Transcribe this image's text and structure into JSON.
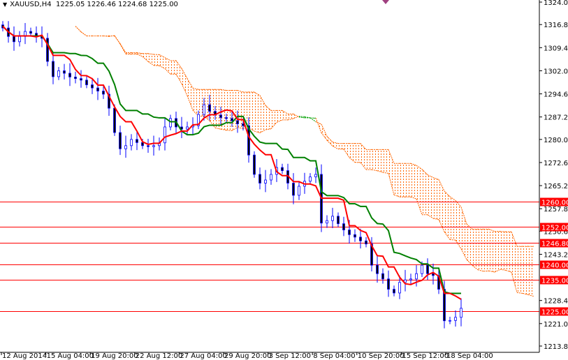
{
  "header": {
    "symbol": "XAUUSD,H4",
    "ohlc": "1225.05 1226.46 1224.68 1225.00"
  },
  "colors": {
    "tenkan": "#ff0000",
    "kijun": "#008000",
    "candle": "#0000ff",
    "level": "#ff0000",
    "cloud_bear": "#ff6600",
    "cloud_bull": "#00a000"
  },
  "chart_data": {
    "type": "candlestick",
    "title": "XAUUSD,H4",
    "ylim": [
      1213.8,
      1324.0
    ],
    "y_ticks": [
      "1324.00",
      "1316.80",
      "1309.40",
      "1302.00",
      "1294.60",
      "1287.20",
      "1280.00",
      "1272.60",
      "1265.20",
      "1257.80",
      "1250.60",
      "1243.20",
      "1228.40",
      "1221.00",
      "1213.80"
    ],
    "x_ticks": [
      "12 Aug 2014",
      "15 Aug 04:00",
      "19 Aug 20:00",
      "22 Aug 12:00",
      "27 Aug 04:00",
      "29 Aug 20:00",
      "3 Sep 12:00",
      "8 Sep 04:00",
      "10 Sep 20:00",
      "15 Sep 12:00",
      "18 Sep 04:00"
    ],
    "levels": [
      "1260.00",
      "1252.00",
      "1246.80",
      "1240.00",
      "1235.00",
      "1225.00"
    ],
    "closes": [
      1315.7,
      1313,
      1311.3,
      1313,
      1314.6,
      1314,
      1313,
      1312.4,
      1305,
      1300.1,
      1302,
      1301.2,
      1300,
      1299.5,
      1299,
      1297.5,
      1296.5,
      1295.5,
      1294.5,
      1290,
      1282.2,
      1277,
      1278,
      1280,
      1279,
      1278,
      1277.7,
      1278,
      1278.9,
      1284,
      1286.7,
      1284,
      1283.3,
      1284,
      1284.4,
      1288,
      1291.1,
      1289,
      1287.8,
      1287,
      1286.7,
      1286,
      1285,
      1284.4,
      1275,
      1268.8,
      1266,
      1267,
      1268.8,
      1271,
      1270,
      1266,
      1262.1,
      1265,
      1266.6,
      1268,
      1268.8,
      1253.2,
      1254,
      1255.4,
      1253,
      1251,
      1249.5,
      1248.7,
      1247.5,
      1246.5,
      1239.7,
      1237,
      1235.3,
      1232,
      1230.8,
      1234.2,
      1235,
      1235.3,
      1237,
      1239.7,
      1237,
      1236.4,
      1232,
      1221.9,
      1222,
      1223,
      1225.9
    ],
    "indicators": [
      "Ichimoku Tenkan-sen (red)",
      "Ichimoku Kijun-sen (green)",
      "Ichimoku Kumo cloud"
    ]
  }
}
